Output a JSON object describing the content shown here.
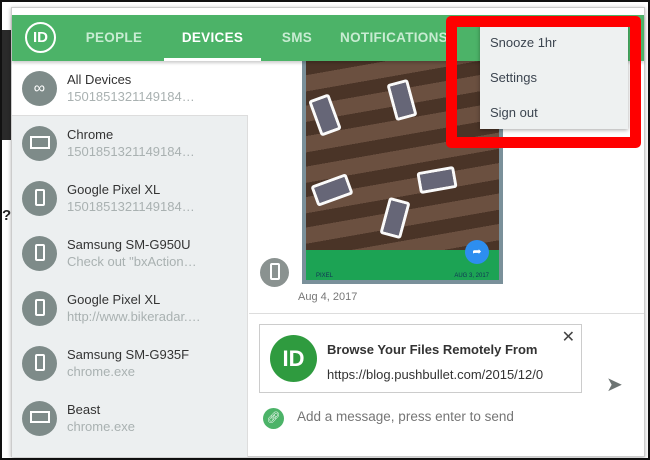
{
  "header": {
    "logo": "pushbullet-logo",
    "tabs": [
      {
        "label": "PEOPLE"
      },
      {
        "label": "DEVICES",
        "active": true
      },
      {
        "label": "SMS"
      },
      {
        "label": "NOTIFICATIONS"
      }
    ]
  },
  "devices": [
    {
      "name": "All Devices",
      "sub": "1501851321149184…",
      "icon": "infinity-icon"
    },
    {
      "name": "Chrome",
      "sub": "1501851321149184…",
      "icon": "browser-icon"
    },
    {
      "name": "Google Pixel XL",
      "sub": "1501851321149184…",
      "icon": "phone-icon"
    },
    {
      "name": "Samsung SM-G950U",
      "sub": "Check out \"bxAction…",
      "icon": "phone-icon"
    },
    {
      "name": "Google Pixel XL",
      "sub": "http://www.bikeradar.…",
      "icon": "phone-icon"
    },
    {
      "name": "Samsung SM-G935F",
      "sub": "chrome.exe",
      "icon": "phone-icon"
    },
    {
      "name": "Beast",
      "sub": "chrome.exe",
      "icon": "desktop-icon"
    }
  ],
  "message": {
    "image_left": "PIXEL",
    "image_right": "AUG 3, 2017",
    "date": "Aug 4, 2017"
  },
  "link_card": {
    "title": "Browse Your Files Remotely From",
    "url": "https://blog.pushbullet.com/2015/12/0",
    "close": "✕"
  },
  "composer": {
    "placeholder": "Add a message, press enter to send"
  },
  "menu": {
    "items": [
      "Snooze 1hr",
      "Settings",
      "Sign out"
    ]
  },
  "colors": {
    "header": "#4cb368",
    "highlight": "#ff0000"
  }
}
